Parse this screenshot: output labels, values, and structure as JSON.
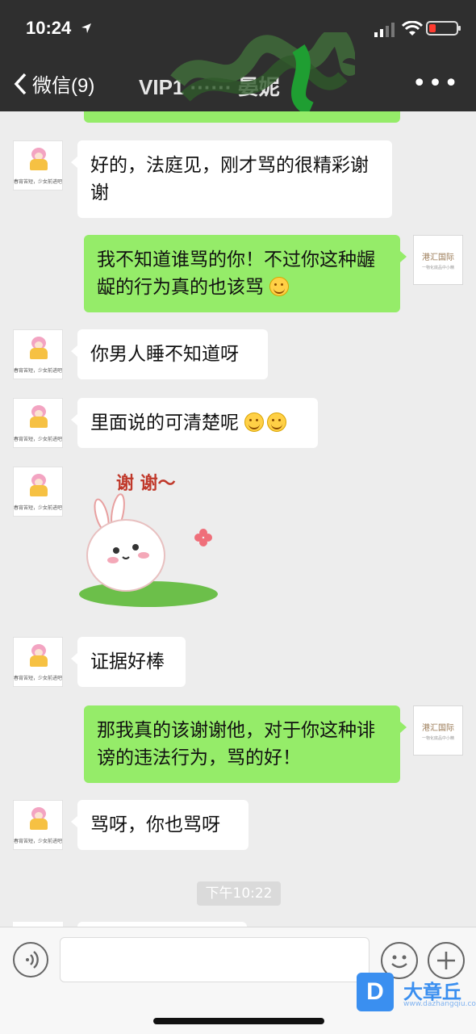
{
  "status": {
    "time": "10:24"
  },
  "nav": {
    "back_label": "微信(9)",
    "title": "VIP1  ······  晏妮",
    "more": "•••"
  },
  "messages": [
    {
      "side": "in",
      "text": "好的，法庭见，刚才骂的很精彩谢谢"
    },
    {
      "side": "out",
      "text": "我不知道谁骂的你！不过你这种龌龊的行为真的也该骂"
    },
    {
      "side": "in",
      "text": "你男人睡不知道呀"
    },
    {
      "side": "in",
      "text": "里面说的可清楚呢"
    },
    {
      "side": "in",
      "sticker_text": "谢 谢～"
    },
    {
      "side": "in",
      "text": "证据好棒"
    },
    {
      "side": "out",
      "text": "那我真的该谢谢他，对于你这种诽谤的违法行为，骂的好！"
    },
    {
      "side": "in",
      "text": "骂呀，你也骂呀"
    }
  ],
  "avatars": {
    "left_caption": "春宵苦短，少女前进吧",
    "right_logo": "港汇国际",
    "right_sub": "一物化底品中小精"
  },
  "timestamp": "下午10:22",
  "watermark": {
    "badge": "D",
    "name": "大章丘",
    "sub": "www.dazhangqiu.com"
  }
}
